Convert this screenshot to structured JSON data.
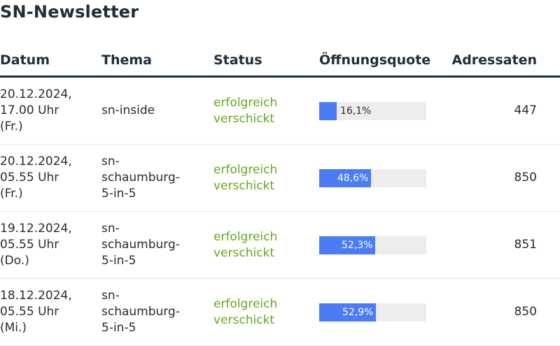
{
  "page": {
    "title": "SN-Newsletter"
  },
  "table": {
    "headers": {
      "datum": "Datum",
      "thema": "Thema",
      "status": "Status",
      "oeffnungsquote": "Öffnungsquote",
      "adressaten": "Adressaten"
    },
    "rows": [
      {
        "date_lines": [
          "20.12.2024,",
          "17.00 Uhr",
          "(Fr.)"
        ],
        "topic_lines": [
          "sn-inside"
        ],
        "status_lines": [
          "erfolgreich",
          "verschickt"
        ],
        "rate_label": "16,1%",
        "rate_value": 16.1,
        "recipients": "447"
      },
      {
        "date_lines": [
          "20.12.2024,",
          "05.55 Uhr",
          "(Fr.)"
        ],
        "topic_lines": [
          "sn-",
          "schaumburg-",
          "5-in-5"
        ],
        "status_lines": [
          "erfolgreich",
          "verschickt"
        ],
        "rate_label": "48,6%",
        "rate_value": 48.6,
        "recipients": "850"
      },
      {
        "date_lines": [
          "19.12.2024,",
          "05.55 Uhr",
          "(Do.)"
        ],
        "topic_lines": [
          "sn-",
          "schaumburg-",
          "5-in-5"
        ],
        "status_lines": [
          "erfolgreich",
          "verschickt"
        ],
        "rate_label": "52,3%",
        "rate_value": 52.3,
        "recipients": "851"
      },
      {
        "date_lines": [
          "18.12.2024,",
          "05.55 Uhr",
          "(Mi.)"
        ],
        "topic_lines": [
          "sn-",
          "schaumburg-",
          "5-in-5"
        ],
        "status_lines": [
          "erfolgreich",
          "verschickt"
        ],
        "rate_label": "52,9%",
        "rate_value": 52.9,
        "recipients": "850"
      }
    ]
  },
  "colors": {
    "success": "#63a81f",
    "bar_fill": "#4b7bf5",
    "bar_track": "#ededed",
    "heading": "#1f2d3a"
  }
}
